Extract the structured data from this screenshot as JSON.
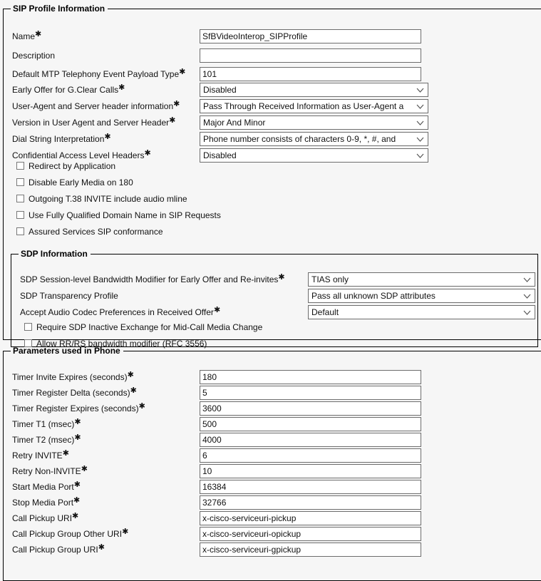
{
  "sip_profile": {
    "legend": "SIP Profile Information",
    "fields": [
      {
        "label": "Name",
        "required": true,
        "type": "text",
        "value": "SfBVideoInterop_SIPProfile"
      },
      {
        "label": "Description",
        "required": false,
        "type": "text",
        "value": ""
      },
      {
        "label": "Default MTP Telephony Event Payload Type",
        "required": true,
        "type": "text",
        "value": "101"
      },
      {
        "label": "Early Offer for G.Clear Calls",
        "required": true,
        "type": "select",
        "value": "Disabled"
      },
      {
        "label": "User-Agent and Server header information",
        "required": true,
        "type": "select",
        "value": "Pass Through Received Information as User-Agent a"
      },
      {
        "label": "Version in User Agent and Server Header",
        "required": true,
        "type": "select",
        "value": "Major And Minor"
      },
      {
        "label": "Dial String Interpretation",
        "required": true,
        "type": "select",
        "value": "Phone number consists of characters 0-9, *, #, and"
      },
      {
        "label": "Confidential Access Level Headers",
        "required": true,
        "type": "select",
        "value": "Disabled"
      }
    ],
    "checkboxes": [
      {
        "label": "Redirect by Application",
        "checked": false
      },
      {
        "label": "Disable Early Media on 180",
        "checked": false
      },
      {
        "label": "Outgoing T.38 INVITE include audio mline",
        "checked": false
      },
      {
        "label": "Use Fully Qualified Domain Name in SIP Requests",
        "checked": false
      },
      {
        "label": "Assured Services SIP conformance",
        "checked": false
      }
    ]
  },
  "sdp_information": {
    "legend": "SDP Information",
    "fields": [
      {
        "label": "SDP Session-level Bandwidth Modifier for Early Offer and Re-invites",
        "required": true,
        "type": "select",
        "value": "TIAS only"
      },
      {
        "label": "SDP Transparency Profile",
        "required": false,
        "type": "select",
        "value": "Pass all unknown SDP attributes"
      },
      {
        "label": "Accept Audio Codec Preferences in Received Offer",
        "required": true,
        "type": "select",
        "value": "Default"
      }
    ],
    "checkboxes": [
      {
        "label": "Require SDP Inactive Exchange for Mid-Call Media Change",
        "checked": false
      },
      {
        "label": "Allow RR/RS bandwidth modifier (RFC 3556)",
        "checked": false
      }
    ]
  },
  "parameters_used_in_phone": {
    "legend": "Parameters used in Phone",
    "fields": [
      {
        "label": "Timer Invite Expires (seconds)",
        "required": true,
        "type": "text",
        "value": "180"
      },
      {
        "label": "Timer Register Delta (seconds)",
        "required": true,
        "type": "text",
        "value": "5"
      },
      {
        "label": "Timer Register Expires (seconds)",
        "required": true,
        "type": "text",
        "value": "3600"
      },
      {
        "label": "Timer T1 (msec)",
        "required": true,
        "type": "text",
        "value": "500"
      },
      {
        "label": "Timer T2 (msec)",
        "required": true,
        "type": "text",
        "value": "4000"
      },
      {
        "label": "Retry INVITE",
        "required": true,
        "type": "text",
        "value": "6"
      },
      {
        "label": "Retry Non-INVITE",
        "required": true,
        "type": "text",
        "value": "10"
      },
      {
        "label": "Start Media Port",
        "required": true,
        "type": "text",
        "value": "16384"
      },
      {
        "label": "Stop Media Port",
        "required": true,
        "type": "text",
        "value": "32766"
      },
      {
        "label": "Call Pickup URI",
        "required": true,
        "type": "text",
        "value": "x-cisco-serviceuri-pickup"
      },
      {
        "label": "Call Pickup Group Other URI",
        "required": true,
        "type": "text",
        "value": "x-cisco-serviceuri-opickup"
      },
      {
        "label": "Call Pickup Group URI",
        "required": true,
        "type": "text",
        "value": "x-cisco-serviceuri-gpickup"
      }
    ]
  },
  "icons": {
    "dropdown": "chevron-down-icon",
    "required_marker": "asterisk-required-icon"
  },
  "colors": {
    "page_background": "#f6f6f6",
    "field_border": "#6d6d6d",
    "group_border": "#000000",
    "field_background": "#ffffff",
    "text": "#111111"
  }
}
